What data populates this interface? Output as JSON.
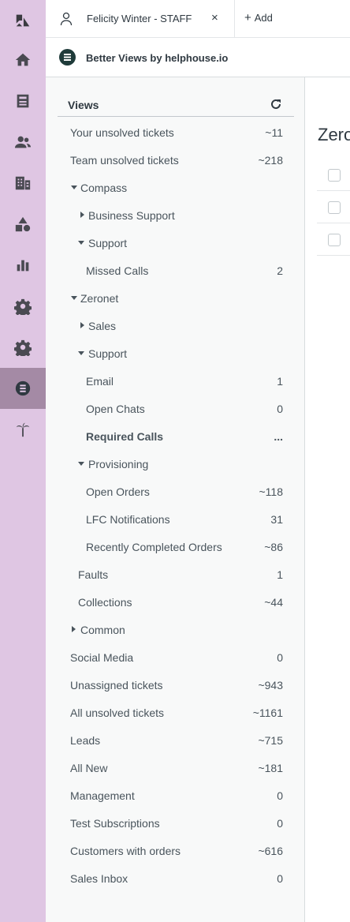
{
  "rail": {
    "items": [
      {
        "icon": "zendesk-logo-icon"
      },
      {
        "icon": "home-icon"
      },
      {
        "icon": "inbox-icon"
      },
      {
        "icon": "users-icon"
      },
      {
        "icon": "organizations-icon"
      },
      {
        "icon": "shapes-icon"
      },
      {
        "icon": "reporting-icon"
      },
      {
        "icon": "settings-icon"
      },
      {
        "icon": "admin-icon"
      },
      {
        "icon": "better-views-app-icon"
      },
      {
        "icon": "palm-tree-icon"
      }
    ],
    "active_index": 9,
    "colors": {
      "background": "#dfc6e3",
      "active": "#a48aa5"
    }
  },
  "tabbar": {
    "tab_label": "Felicity Winter - STAFF",
    "close_symbol": "×",
    "add_label": "Add",
    "add_symbol": "+"
  },
  "app": {
    "title": "Better Views by helphouse.io"
  },
  "views": {
    "title": "Views",
    "rows": [
      {
        "label": "Your unsolved tickets",
        "count": "~11"
      },
      {
        "label": "Team unsolved tickets",
        "count": "~218"
      },
      {
        "label": "Compass",
        "count": ""
      },
      {
        "label": "Business Support",
        "count": ""
      },
      {
        "label": "Support",
        "count": ""
      },
      {
        "label": "Missed Calls",
        "count": "2"
      },
      {
        "label": "Zeronet",
        "count": ""
      },
      {
        "label": "Sales",
        "count": ""
      },
      {
        "label": "Support",
        "count": ""
      },
      {
        "label": "Email",
        "count": "1"
      },
      {
        "label": "Open Chats",
        "count": "0"
      },
      {
        "label": "Required Calls",
        "count": "..."
      },
      {
        "label": "Provisioning",
        "count": ""
      },
      {
        "label": "Open Orders",
        "count": "~118"
      },
      {
        "label": "LFC Notifications",
        "count": "31"
      },
      {
        "label": "Recently Completed Orders",
        "count": "~86"
      },
      {
        "label": "Faults",
        "count": "1"
      },
      {
        "label": "Collections",
        "count": "~44"
      },
      {
        "label": "Common",
        "count": ""
      },
      {
        "label": "Social Media",
        "count": "0"
      },
      {
        "label": "Unassigned tickets",
        "count": "~943"
      },
      {
        "label": "All unsolved tickets",
        "count": "~1161"
      },
      {
        "label": "Leads",
        "count": "~715"
      },
      {
        "label": "All New",
        "count": "~181"
      },
      {
        "label": "Management",
        "count": "0"
      },
      {
        "label": "Test Subscriptions",
        "count": "0"
      },
      {
        "label": "Customers with orders",
        "count": "~616"
      },
      {
        "label": "Sales Inbox",
        "count": "0"
      }
    ]
  },
  "main": {
    "title": "Zeronet"
  }
}
